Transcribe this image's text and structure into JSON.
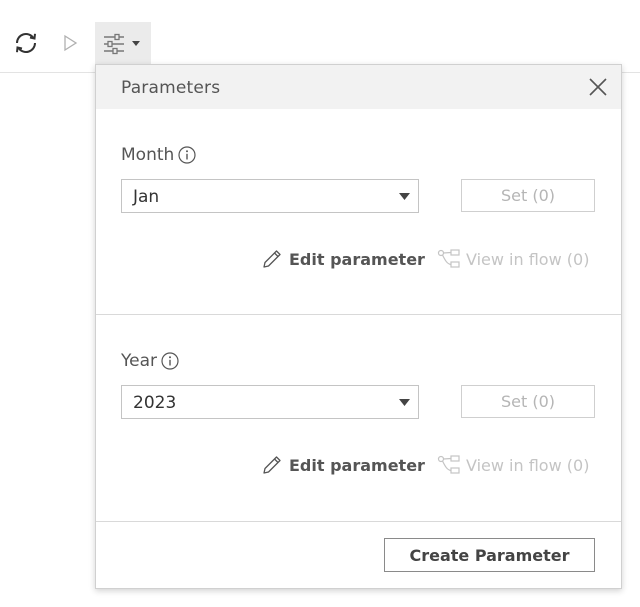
{
  "toolbar": {
    "refresh_icon": "refresh-icon",
    "run_icon": "play-icon",
    "parameters_icon": "sliders-icon"
  },
  "panel": {
    "title": "Parameters",
    "close_icon": "close-icon",
    "parameters": [
      {
        "label": "Month",
        "value": "Jan",
        "set_label": "Set (0)",
        "edit_label": "Edit parameter",
        "view_label": "View in flow (0)"
      },
      {
        "label": "Year",
        "value": "2023",
        "set_label": "Set (0)",
        "edit_label": "Edit parameter",
        "view_label": "View in flow (0)"
      }
    ],
    "create_label": "Create Parameter"
  },
  "colors": {
    "header_bg": "#f2f2f2",
    "disabled_text": "#b5b5b5",
    "active_toolbar_bg": "#ebebeb"
  }
}
